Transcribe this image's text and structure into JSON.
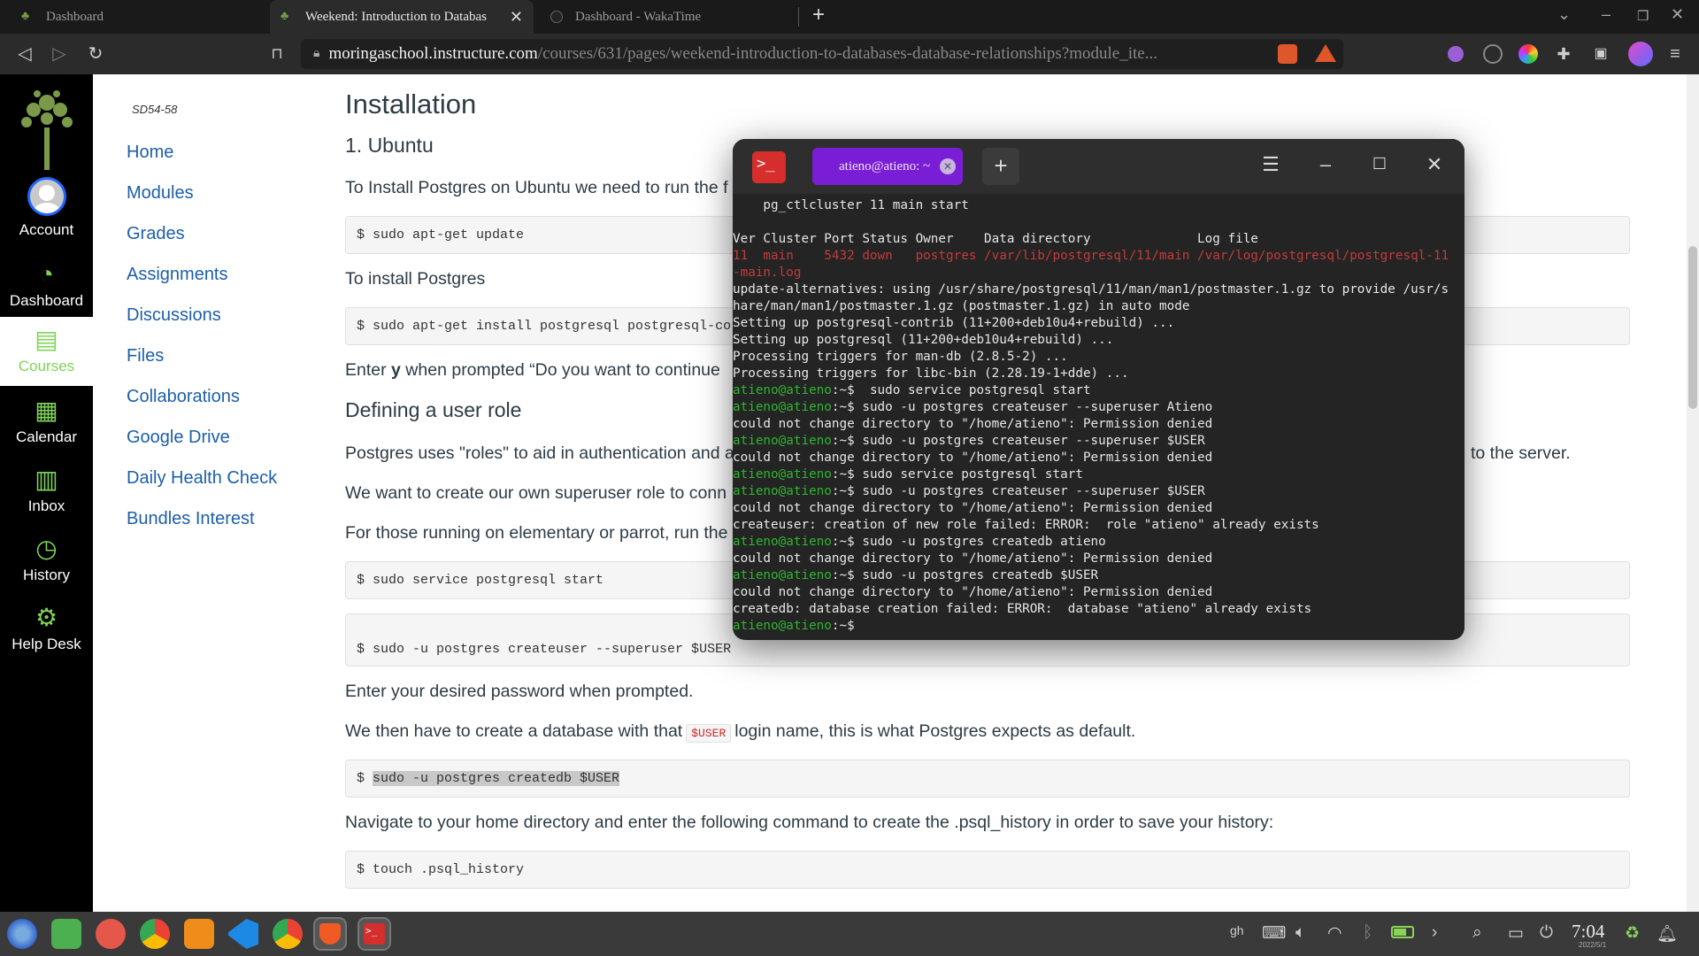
{
  "browser": {
    "tabs": [
      {
        "title": "Dashboard"
      },
      {
        "title": "Weekend: Introduction to Databas"
      },
      {
        "title": "Dashboard - WakaTime"
      }
    ],
    "new_tab": "+",
    "url_host": "moringaschool.instructure.com",
    "url_path": "/courses/631/pages/weekend-introduction-to-databases-database-relationships?module_ite..."
  },
  "global_nav": {
    "items": [
      {
        "label": "Account",
        "icon": "user-icon"
      },
      {
        "label": "Dashboard",
        "icon": "dashboard-icon"
      },
      {
        "label": "Courses",
        "icon": "book-icon"
      },
      {
        "label": "Calendar",
        "icon": "calendar-icon"
      },
      {
        "label": "Inbox",
        "icon": "inbox-icon"
      },
      {
        "label": "History",
        "icon": "clock-icon"
      },
      {
        "label": "Help Desk",
        "icon": "gear-icon"
      }
    ]
  },
  "course_nav": {
    "code": "SD54-58",
    "links": [
      "Home",
      "Modules",
      "Grades",
      "Assignments",
      "Discussions",
      "Files",
      "Collaborations",
      "Google Drive",
      "Daily Health Check",
      "Bundles Interest"
    ]
  },
  "content": {
    "heading": "Installation",
    "sub_ubuntu": "1. Ubuntu",
    "p_install_ubuntu": "To Install Postgres on Ubuntu we need to run the f",
    "code_update": "$ sudo apt-get update",
    "p_install_postgres": "To install Postgres",
    "code_install": "$ sudo apt-get install postgresql postgresql-co",
    "p_enter_y_pre": "Enter ",
    "p_enter_y_bold": "y",
    "p_enter_y_post": " when prompted “Do you want to continue",
    "sub_user_role": "Defining a user role",
    "p_roles": "Postgres uses \"roles\" to aid in authentication and a",
    "p_roles_tail": "to the server.",
    "p_superuser": "We want to create our own superuser role to conn",
    "p_elementary": "For those running on elementary or parrot, run the",
    "code_service": "$ sudo service postgresql start",
    "code_createuser": "$ sudo -u postgres createuser --superuser $USER",
    "p_password": "Enter your desired password when prompted.",
    "p_createdb_pre": "We then have to create a database with that",
    "p_createdb_code": "$USER",
    "p_createdb_post": "login name, this is what Postgres expects as default.",
    "code_createdb_prefix": "$ ",
    "code_createdb_sel": "sudo -u postgres createdb $USER",
    "p_navigate": "Navigate to your home directory and enter the following command to create the .psql_history in order to save your history:",
    "code_touch": "$ touch .psql_history"
  },
  "terminal": {
    "tab_title": "atieno@atieno: ~",
    "prompt": "atieno@atieno",
    "lines": [
      {
        "kind": "plain",
        "text": "    pg_ctlcluster 11 main start"
      },
      {
        "kind": "plain",
        "text": ""
      },
      {
        "kind": "plain",
        "text": "Ver Cluster Port Status Owner    Data directory              Log file"
      },
      {
        "kind": "red",
        "text": "11  main    5432 down   postgres /var/lib/postgresql/11/main /var/log/postgresql/postgresql-11"
      },
      {
        "kind": "red",
        "text": "-main.log"
      },
      {
        "kind": "plain",
        "text": "update-alternatives: using /usr/share/postgresql/11/man/man1/postmaster.1.gz to provide /usr/s"
      },
      {
        "kind": "plain",
        "text": "hare/man/man1/postmaster.1.gz (postmaster.1.gz) in auto mode"
      },
      {
        "kind": "plain",
        "text": "Setting up postgresql-contrib (11+200+deb10u4+rebuild) ..."
      },
      {
        "kind": "plain",
        "text": "Setting up postgresql (11+200+deb10u4+rebuild) ..."
      },
      {
        "kind": "plain",
        "text": "Processing triggers for man-db (2.8.5-2) ..."
      },
      {
        "kind": "plain",
        "text": "Processing triggers for libc-bin (2.28.19-1+dde) ..."
      },
      {
        "kind": "cmd",
        "text": ":~$  sudo service postgresql start"
      },
      {
        "kind": "cmd",
        "text": ":~$ sudo -u postgres createuser --superuser Atieno"
      },
      {
        "kind": "plain",
        "text": "could not change directory to \"/home/atieno\": Permission denied"
      },
      {
        "kind": "cmd",
        "text": ":~$ sudo -u postgres createuser --superuser $USER"
      },
      {
        "kind": "plain",
        "text": "could not change directory to \"/home/atieno\": Permission denied"
      },
      {
        "kind": "cmd",
        "text": ":~$ sudo service postgresql start"
      },
      {
        "kind": "cmd",
        "text": ":~$ sudo -u postgres createuser --superuser $USER"
      },
      {
        "kind": "plain",
        "text": "could not change directory to \"/home/atieno\": Permission denied"
      },
      {
        "kind": "plain",
        "text": "createuser: creation of new role failed: ERROR:  role \"atieno\" already exists"
      },
      {
        "kind": "cmd",
        "text": ":~$ sudo -u postgres createdb atieno"
      },
      {
        "kind": "plain",
        "text": "could not change directory to \"/home/atieno\": Permission denied"
      },
      {
        "kind": "cmd",
        "text": ":~$ sudo -u postgres createdb $USER"
      },
      {
        "kind": "plain",
        "text": "could not change directory to \"/home/atieno\": Permission denied"
      },
      {
        "kind": "plain",
        "text": "createdb: database creation failed: ERROR:  database \"atieno\" already exists"
      },
      {
        "kind": "cmd",
        "text": ":~$ "
      }
    ]
  },
  "taskbar": {
    "clock": "7:04",
    "date": "2022/5/1"
  },
  "colors": {
    "canvas_green": "#7fd457",
    "link_blue": "#1d5fa8",
    "terminal_prompt": "#2db52d",
    "terminal_tab": "#7a1ed6"
  }
}
